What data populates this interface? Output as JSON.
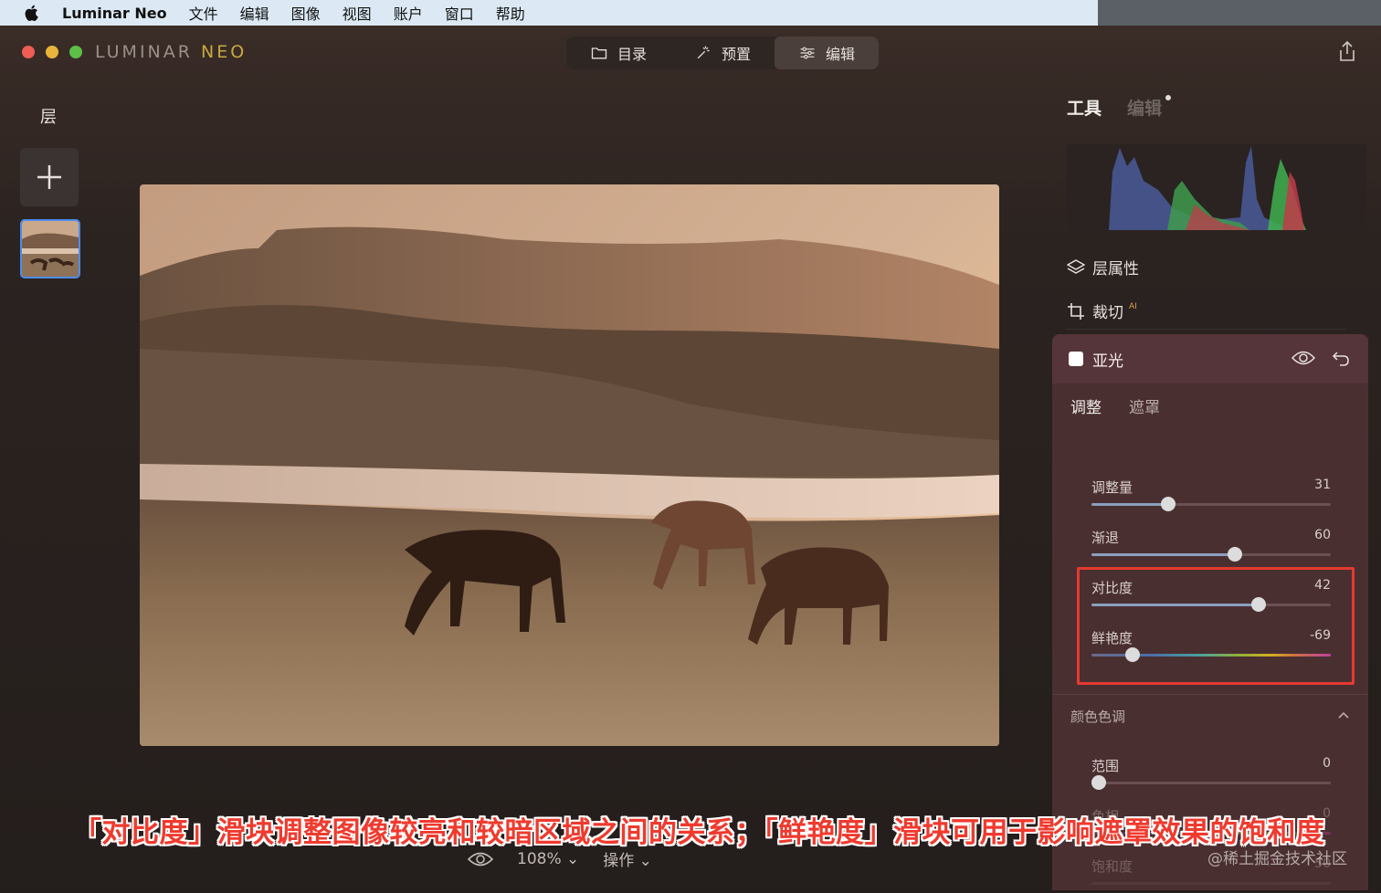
{
  "menubar": {
    "app": "Luminar Neo",
    "items": [
      "文件",
      "编辑",
      "图像",
      "视图",
      "账户",
      "窗口",
      "帮助"
    ]
  },
  "window": {
    "logo_light": "LUMINAR ",
    "logo_accent": "NEO",
    "tabs": [
      {
        "label": "目录",
        "icon": "folder-icon"
      },
      {
        "label": "预置",
        "icon": "magic-wand-icon"
      },
      {
        "label": "编辑",
        "icon": "sliders-icon",
        "active": true
      }
    ]
  },
  "layers": {
    "title": "层"
  },
  "bottom_bar": {
    "zoom": "108%",
    "zoom_caret": "⌄",
    "actions": "操作",
    "actions_caret": "⌄"
  },
  "right_panel": {
    "tabs": {
      "tools": "工具",
      "edits": "编辑"
    },
    "items": [
      {
        "label": "层属性",
        "icon": "layers-icon"
      },
      {
        "label": "裁切",
        "icon": "crop-icon",
        "badge": "AI"
      }
    ],
    "matte": {
      "title": "亚光",
      "subtabs": {
        "adjust": "调整",
        "mask": "遮罩"
      },
      "sliders": [
        {
          "label": "调整量",
          "value": "31",
          "position": 0.32
        },
        {
          "label": "渐退",
          "value": "60",
          "position": 0.6
        },
        {
          "label": "对比度",
          "value": "42",
          "position": 0.7
        },
        {
          "label": "鲜艳度",
          "value": "-69",
          "position": 0.17
        }
      ],
      "section": {
        "title": "颜色色调",
        "sliders": [
          {
            "label": "范围",
            "value": "0",
            "position": 0.03
          },
          {
            "label": "色相",
            "value": "0",
            "position": 0.03
          },
          {
            "label": "饱和度",
            "value": "50",
            "position": 0.5
          }
        ]
      }
    }
  },
  "caption": "「对比度」滑块调整图像较亮和较暗区域之间的关系；「鲜艳度」滑块可用于影响遮罩效果的饱和度",
  "watermark": "@稀土掘金技术社区",
  "colors": {
    "highlight": "#e53a2f",
    "caption": "#ef3a2e",
    "panel": "#4a2f31"
  }
}
